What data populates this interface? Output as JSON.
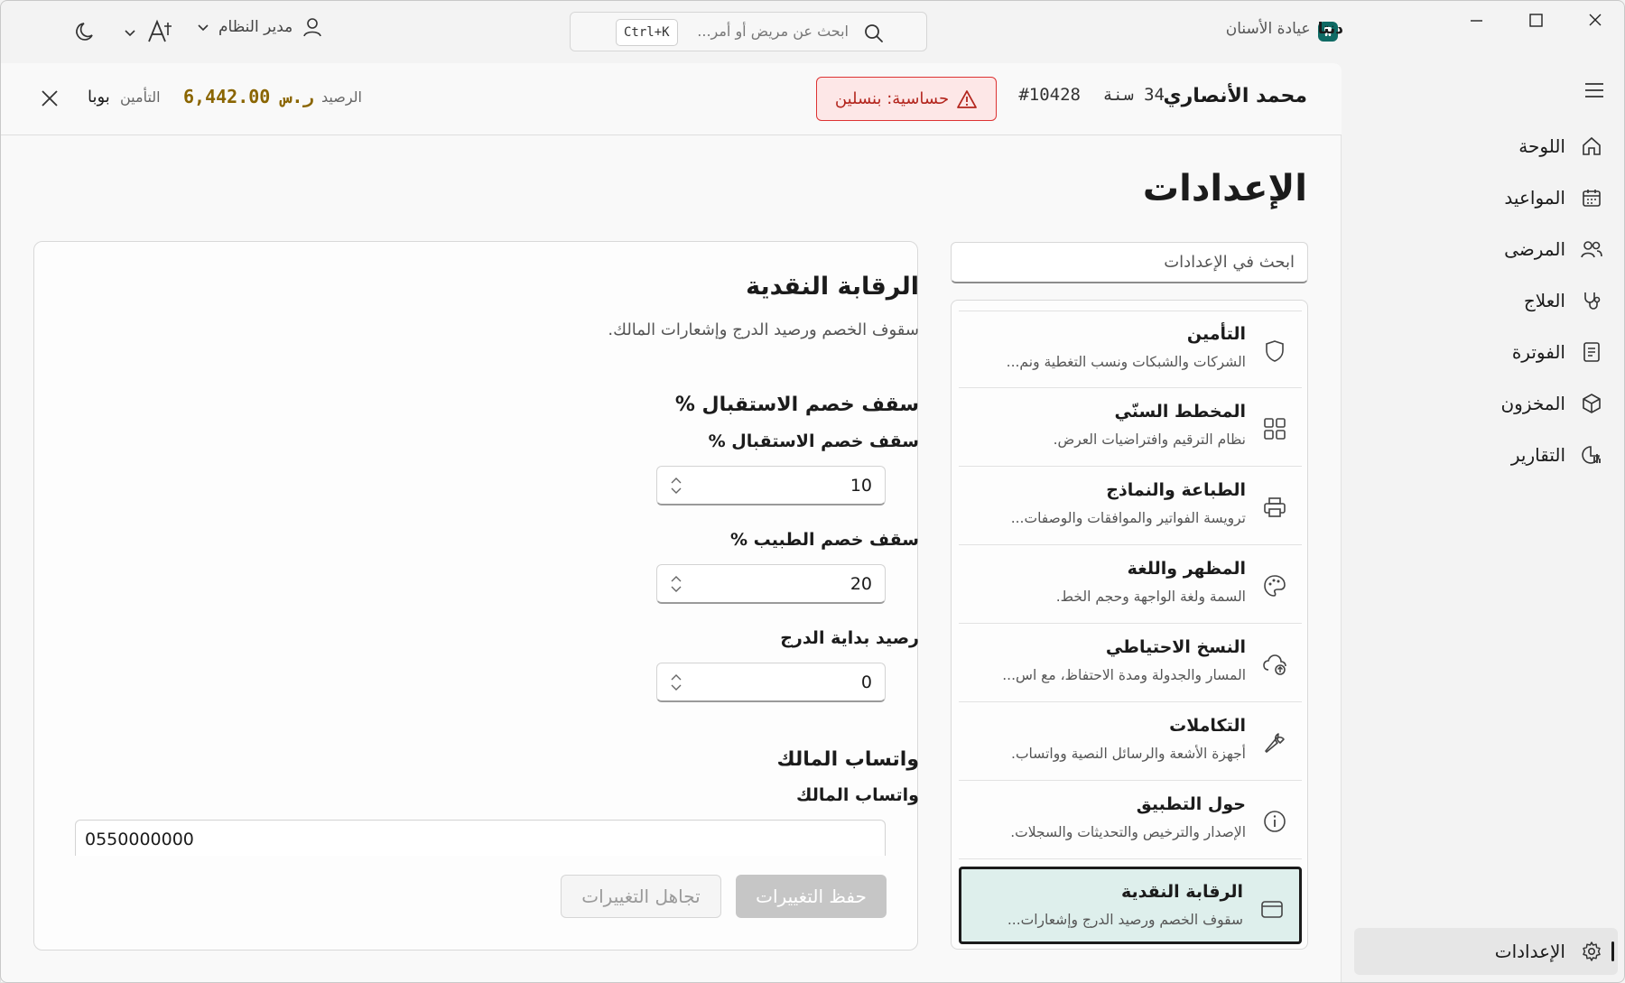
{
  "titlebar": {
    "app_name": "دنتا",
    "app_subtitle": "عيادة الأسنان",
    "search_placeholder": "ابحث عن مريض أو أمر...",
    "search_shortcut": "Ctrl+K",
    "user_role": "مدير النظام"
  },
  "sidebar": {
    "items": [
      {
        "label": "اللوحة",
        "icon": "home-icon"
      },
      {
        "label": "المواعيد",
        "icon": "calendar-icon"
      },
      {
        "label": "المرضى",
        "icon": "users-icon"
      },
      {
        "label": "العلاج",
        "icon": "stethoscope-icon"
      },
      {
        "label": "الفوترة",
        "icon": "invoice-icon"
      },
      {
        "label": "المخزون",
        "icon": "box-icon"
      },
      {
        "label": "التقارير",
        "icon": "chart-icon"
      }
    ],
    "settings_label": "الإعدادات"
  },
  "patient": {
    "name": "محمد الأنصاري",
    "age": "34 سنة",
    "id": "#10428",
    "allergy": "حساسية: بنسلين",
    "balance_label": "الرصيد",
    "balance_value": "6,442.00 ر.س",
    "insurance_label": "التأمين",
    "insurance_value": "بوبا"
  },
  "page": {
    "title": "الإعدادات",
    "search_placeholder": "ابحث في الإعدادات"
  },
  "settings_items": [
    {
      "title": "التأمين",
      "desc": "الشركات والشبكات ونسب التغطية ونم...",
      "icon": "shield-icon"
    },
    {
      "title": "المخطط السنّي",
      "desc": "نظام الترقيم وافتراضيات العرض.",
      "icon": "grid-icon"
    },
    {
      "title": "الطباعة والنماذج",
      "desc": "ترويسة الفواتير والموافقات والوصفات...",
      "icon": "printer-icon"
    },
    {
      "title": "المظهر واللغة",
      "desc": "السمة ولغة الواجهة وحجم الخط.",
      "icon": "palette-icon"
    },
    {
      "title": "النسخ الاحتياطي",
      "desc": "المسار والجدولة ومدة الاحتفاظ، مع اس...",
      "icon": "cloud-upload-icon"
    },
    {
      "title": "التكاملات",
      "desc": "أجهزة الأشعة والرسائل النصية وواتساب.",
      "icon": "wrench-icon"
    },
    {
      "title": "حول التطبيق",
      "desc": "الإصدار والترخيص والتحديثات والسجلات.",
      "icon": "info-icon"
    },
    {
      "title": "الرقابة النقدية",
      "desc": "سقوف الخصم ورصيد الدرج وإشعارات...",
      "icon": "wallet-icon"
    }
  ],
  "form": {
    "title": "الرقابة النقدية",
    "subtitle": "سقوف الخصم ورصيد الدرج وإشعارات المالك.",
    "section1": "سقف خصم الاستقبال %",
    "field_reception_label": "سقف خصم الاستقبال %",
    "field_reception_value": "10",
    "field_doctor_label": "سقف خصم الطبيب %",
    "field_doctor_value": "20",
    "field_drawer_label": "رصيد بداية الدرج",
    "field_drawer_value": "0",
    "section2": "واتساب المالك",
    "field_whatsapp_label": "واتساب المالك",
    "field_whatsapp_value": "0550000000",
    "save_label": "حفظ التغييرات",
    "ignore_label": "تجاهل التغييرات"
  }
}
